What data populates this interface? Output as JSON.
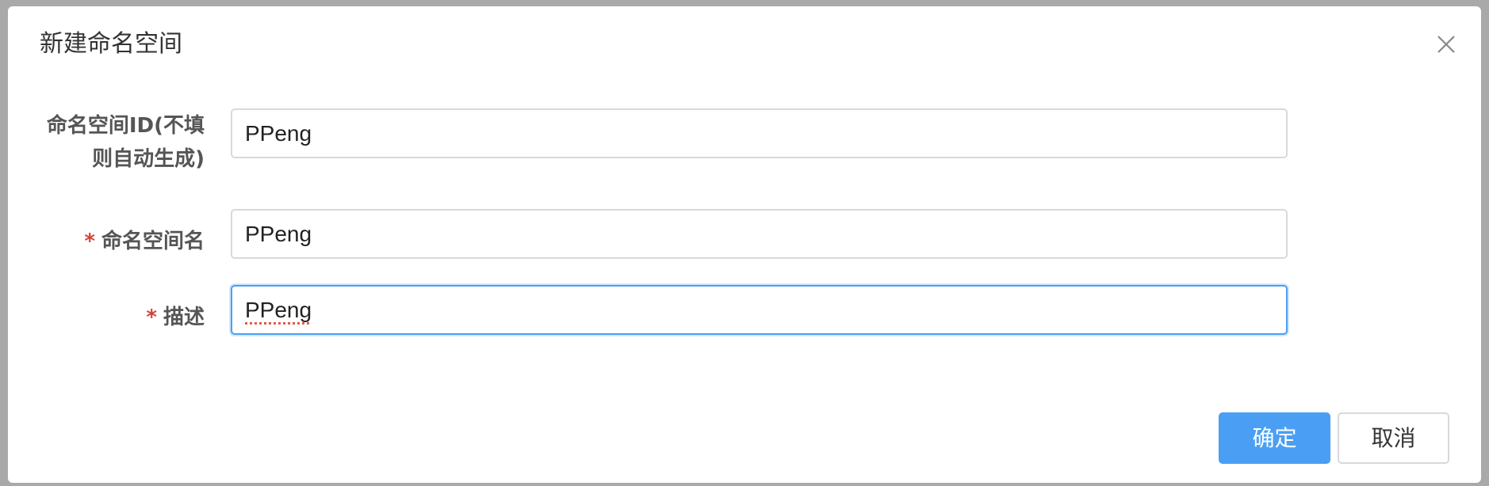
{
  "dialog": {
    "title": "新建命名空间",
    "close_icon": "close-icon"
  },
  "form": {
    "namespace_id": {
      "label_line1": "命名空间ID(不填",
      "label_line2": "则自动生成)",
      "value": "PPeng"
    },
    "namespace_name": {
      "required_mark": "*",
      "label": "命名空间名",
      "value": "PPeng"
    },
    "description": {
      "required_mark": "*",
      "label": "描述",
      "value": "PPeng"
    }
  },
  "footer": {
    "confirm_label": "确定",
    "cancel_label": "取消"
  },
  "colors": {
    "primary": "#4a9ff5",
    "required": "#d0453b",
    "border": "#d9d9d9",
    "focus_border": "#4a9ff5"
  }
}
